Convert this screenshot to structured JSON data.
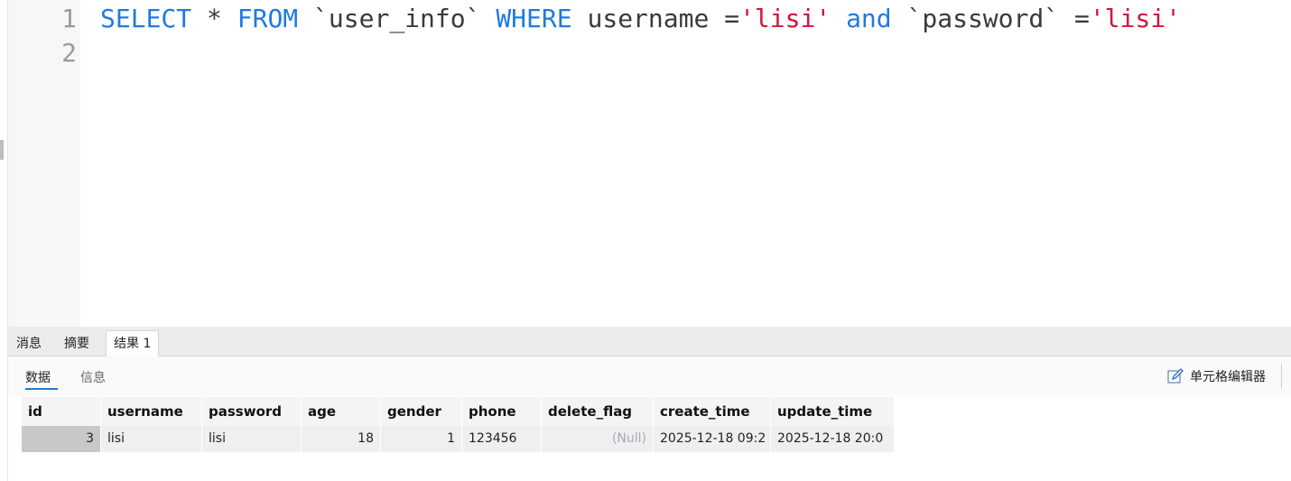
{
  "editor": {
    "line_numbers": [
      "1",
      "2"
    ],
    "sql": {
      "kw_select": "SELECT",
      "t1": " * ",
      "kw_from": "FROM",
      "t2": " `user_info` ",
      "kw_where": "WHERE",
      "t3": " username =",
      "s1": "'lisi'",
      "t4": " ",
      "kw_and": "and",
      "t5": " `password` =",
      "s2": "'lisi'"
    }
  },
  "result_tabs": [
    {
      "label": "消息",
      "active": false
    },
    {
      "label": "摘要",
      "active": false
    },
    {
      "label": "结果 1",
      "active": true
    }
  ],
  "sub_tabs": [
    {
      "label": "数据",
      "active": true
    },
    {
      "label": "信息",
      "active": false
    }
  ],
  "cell_editor_label": "单元格编辑器",
  "grid": {
    "columns": [
      "id",
      "username",
      "password",
      "age",
      "gender",
      "phone",
      "delete_flag",
      "create_time",
      "update_time"
    ],
    "rows": [
      [
        "3",
        "lisi",
        "lisi",
        "18",
        "1",
        "123456",
        "(Null)",
        "2025-12-18 09:2",
        "2025-12-18 20:0"
      ]
    ]
  },
  "colors": {
    "keyword": "#1e7be0",
    "string": "#d4143a",
    "null_text": "#a9a9b8"
  }
}
